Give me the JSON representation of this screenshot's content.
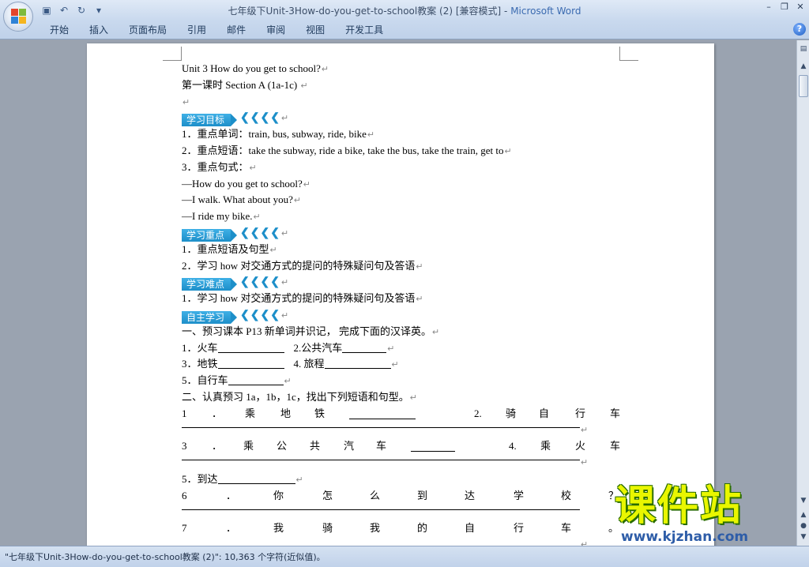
{
  "window": {
    "doc_name": "七年级下Unit-3How-do-you-get-to-school教案 (2) [兼容模式]",
    "separator": " - ",
    "app_name": "Microsoft Word"
  },
  "quick_access": [
    "save-icon",
    "undo-icon",
    "redo-icon",
    "customize-icon"
  ],
  "tabs": [
    "开始",
    "插入",
    "页面布局",
    "引用",
    "邮件",
    "审阅",
    "视图",
    "开发工具"
  ],
  "document": {
    "title": "Unit 3    How do you get to school?",
    "subtitle": "第一课时    Section A (1a-1c)",
    "sections": {
      "goals": "学习目标",
      "key_points": "学习重点",
      "difficulties": "学习难点",
      "self_study": "自主学习"
    },
    "goal_items": [
      "1．重点单词：train, bus, subway, ride, bike",
      "2．重点短语：take the subway, ride a bike, take the bus, take the train, get to",
      "3．重点句式：",
      "—How do you get to school?",
      "—I walk. What about you?",
      "—I ride my bike."
    ],
    "key_items": [
      "1．重点短语及句型",
      "2．学习 how 对交通方式的提问的特殊疑问句及答语"
    ],
    "difficulty_items": [
      "1．学习 how 对交通方式的提问的特殊疑问句及答语"
    ],
    "exercise1_title": "一、预习课本 P13 新单词并识记， 完成下面的汉译英。",
    "ex1": {
      "a1": "1．火车",
      "a2": "2.公共汽车",
      "b1": "3．地铁",
      "b2": "4. 旅程",
      "c1": "5．自行车"
    },
    "exercise2_title": "二、认真预习 1a，1b，1c，找出下列短语和句型。",
    "ex2": {
      "q1": [
        "1",
        "．",
        "乘",
        "地",
        "铁"
      ],
      "q2": [
        "2.",
        "骑",
        "自",
        "行",
        "车"
      ],
      "q3": [
        "3",
        "．",
        "乘",
        "公",
        "共",
        "汽",
        "车"
      ],
      "q4": [
        "4.",
        "乘",
        "火",
        "车"
      ],
      "q5": "5．到达",
      "q6": [
        "6",
        "．",
        "你",
        "怎",
        "么",
        "到",
        "达",
        "学",
        "校",
        "？"
      ],
      "q7": [
        "7",
        "．",
        "我",
        "骑",
        "我",
        "的",
        "自",
        "行",
        "车",
        "。"
      ]
    }
  },
  "status": "\"七年级下Unit-3How-do-you-get-to-school教案 (2)\": 10,363 个字符(近似值)。",
  "watermark": {
    "cn": "课件站",
    "url": "www.kjzhan.com"
  }
}
